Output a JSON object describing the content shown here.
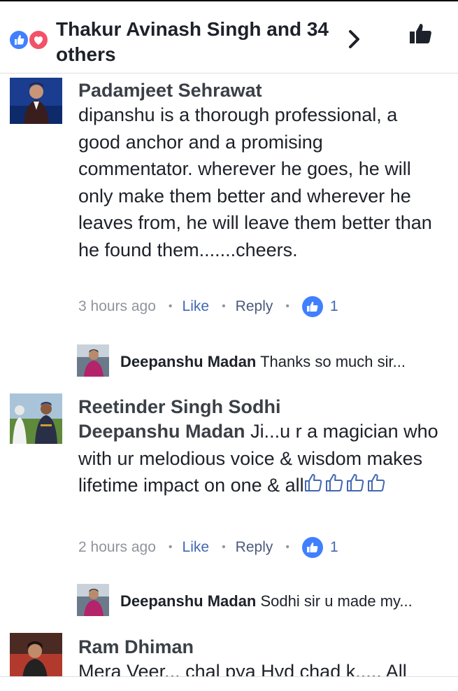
{
  "header": {
    "title": "Thakur Avinash Singh and 34 others",
    "icons": [
      "like-reaction-icon",
      "love-reaction-icon",
      "chevron-right-icon",
      "thumbs-up-icon"
    ]
  },
  "comments": [
    {
      "author": "Padamjeet Sehrawat",
      "mention": "",
      "text": "dipanshu is a thorough professional, a good anchor and a promising commentator. wherever he goes, he will only make them better and wherever he leaves from, he will leave them better than he found them.......cheers.",
      "time": "3 hours ago",
      "like_label": "Like",
      "reply_label": "Reply",
      "like_count": "1",
      "reply": {
        "author": "Deepanshu Madan",
        "text": "Thanks so much sir..."
      }
    },
    {
      "author": "Reetinder Singh Sodhi",
      "mention": "Deepanshu Madan",
      "text": "Ji...u r a magician who with ur melodious voice & wisdom makes lifetime impact on one & all",
      "emoji": "thumbs-up-outline-icon",
      "emoji_count": 4,
      "time": "2 hours ago",
      "like_label": "Like",
      "reply_label": "Reply",
      "like_count": "1",
      "reply": {
        "author": "Deepanshu Madan",
        "text": "Sodhi sir u made my..."
      }
    },
    {
      "author": "Ram Dhiman",
      "text": "Mera Veer... chal pya Hyd chad k..... All"
    }
  ]
}
